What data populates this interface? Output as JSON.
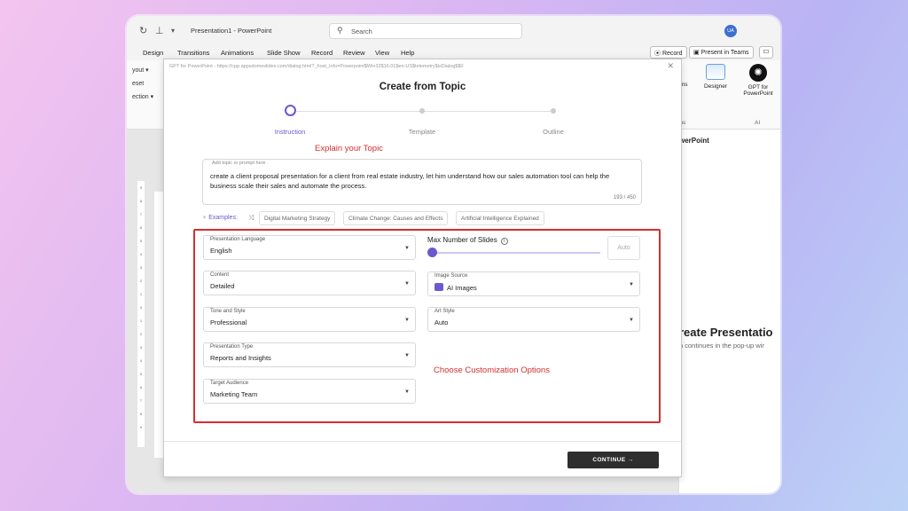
{
  "window": {
    "title": "Presentation1  -  PowerPoint",
    "search_placeholder": "Search",
    "avatar_initials": "UA"
  },
  "menu": {
    "items": [
      "Design",
      "Transitions",
      "Animations",
      "Slide Show",
      "Record",
      "Review",
      "View",
      "Help"
    ],
    "record_label": "Record",
    "present_label": "Present in Teams"
  },
  "ribbon": {
    "left_items": [
      "yout ▾",
      "eset",
      "ection ▾"
    ],
    "addins_label": "-ins",
    "addins_group": "ins",
    "designer_label": "Designer",
    "gpt_label_line1": "GPT for",
    "gpt_label_line2": "PowerPoint",
    "ai_group": "AI"
  },
  "side_pane": {
    "title": "werPoint",
    "heading": "reate Presentatio",
    "subtext": "n continues in the pop-up wir"
  },
  "dialog": {
    "url": "GPT for PowerPoint - https://cpp.appsdomeslides.com/dialog.html?_host_Info=Powerpoint$Win32$16.01$en-US$telemetry$isDialog$$0",
    "title": "Create from Topic",
    "steps": [
      "Instruction",
      "Template",
      "Outline"
    ],
    "annotation_topic": "Explain your Topic",
    "annotation_options": "Choose Customization Options",
    "topic": {
      "placeholder": "Add topic or prompt here",
      "text": "create a client proposal presentation for a client from real estate industry, let him understand how our sales automation tool can help the business scale their sales and automate the process.",
      "count": "193 / 450"
    },
    "examples": {
      "label": "Examples:",
      "chips": [
        "Digital Marketing Strategy",
        "Climate Change: Causes and Effects",
        "Artificial Intelligence Explained"
      ]
    },
    "fields": {
      "language": {
        "label": "Presentation Language",
        "value": "English"
      },
      "content": {
        "label": "Content",
        "value": "Detailed"
      },
      "tone": {
        "label": "Tone and Style",
        "value": "Professional"
      },
      "type": {
        "label": "Presentation Type",
        "value": "Reports and Insights"
      },
      "audience": {
        "label": "Target Audience",
        "value": "Marketing Team"
      },
      "image_source": {
        "label": "Image Source",
        "value": "AI Images"
      },
      "art_style": {
        "label": "Art Style",
        "value": "Auto"
      }
    },
    "slides": {
      "label": "Max Number of Slides",
      "auto": "Auto",
      "slider_value": 0
    },
    "continue_label": "CONTINUE",
    "accent_color": "#6a5acd",
    "annotation_color": "#d32f2f"
  }
}
